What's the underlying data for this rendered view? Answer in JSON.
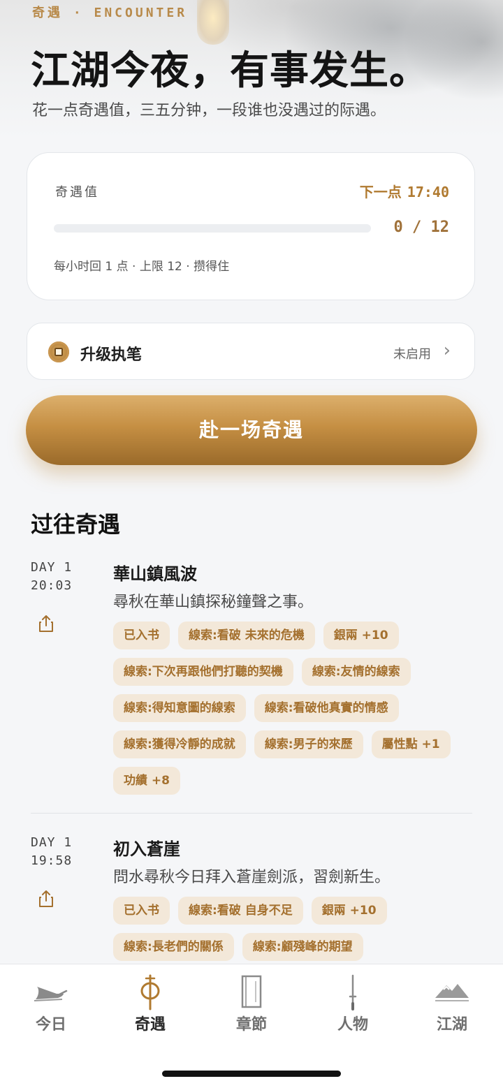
{
  "header": {
    "kicker": "奇遇 · ENCOUNTER",
    "title": "江湖今夜，有事发生。",
    "subtitle": "花一点奇遇值，三五分钟，一段谁也没遇过的际遇。"
  },
  "energy": {
    "label": "奇遇值",
    "next_label": "下一点",
    "next_time": "17:40",
    "count": "0 / 12",
    "progress": 0,
    "rule": "每小时回 1 点 · 上限 12 · 攒得住"
  },
  "upgrade": {
    "title": "升级执笔",
    "status": "未启用",
    "chevron": "›"
  },
  "cta": {
    "label": "赴一场奇遇"
  },
  "history": {
    "title": "过往奇遇",
    "entries": [
      {
        "day": "DAY 1",
        "time": "20:03",
        "title": "華山鎮風波",
        "desc": "尋秋在華山鎮探秘鐘聲之事。",
        "tags": [
          "已入书",
          "線索:看破 未來的危機",
          "銀兩 +10",
          "線索:下次再跟他們打聽的契機",
          "線索:友情的線索",
          "線索:得知意圖的線索",
          "線索:看破他真實的情感",
          "線索:獲得冷靜的成就",
          "線索:男子的來歷",
          "屬性點 +1",
          "功績 +8"
        ]
      },
      {
        "day": "DAY 1",
        "time": "19:58",
        "title": "初入蒼崖",
        "desc": "問水尋秋今日拜入蒼崖劍派，習劍新生。",
        "tags": [
          "已入书",
          "線索:看破 自身不足",
          "銀兩 +10",
          "線索:長老們的關係",
          "線索:顧殘峰的期望"
        ]
      }
    ]
  },
  "tabs": [
    {
      "label": "今日",
      "icon": "brush-icon",
      "active": false
    },
    {
      "label": "奇遇",
      "icon": "lantern-icon",
      "active": true
    },
    {
      "label": "章節",
      "icon": "book-icon",
      "active": false
    },
    {
      "label": "人物",
      "icon": "sword-icon",
      "active": false
    },
    {
      "label": "江湖",
      "icon": "mountain-icon",
      "active": false
    }
  ],
  "colors": {
    "accent": "#c48a3a",
    "tag_bg": "#f3e8d9",
    "tag_text": "#a4702e",
    "background": "#f5f6f8"
  }
}
